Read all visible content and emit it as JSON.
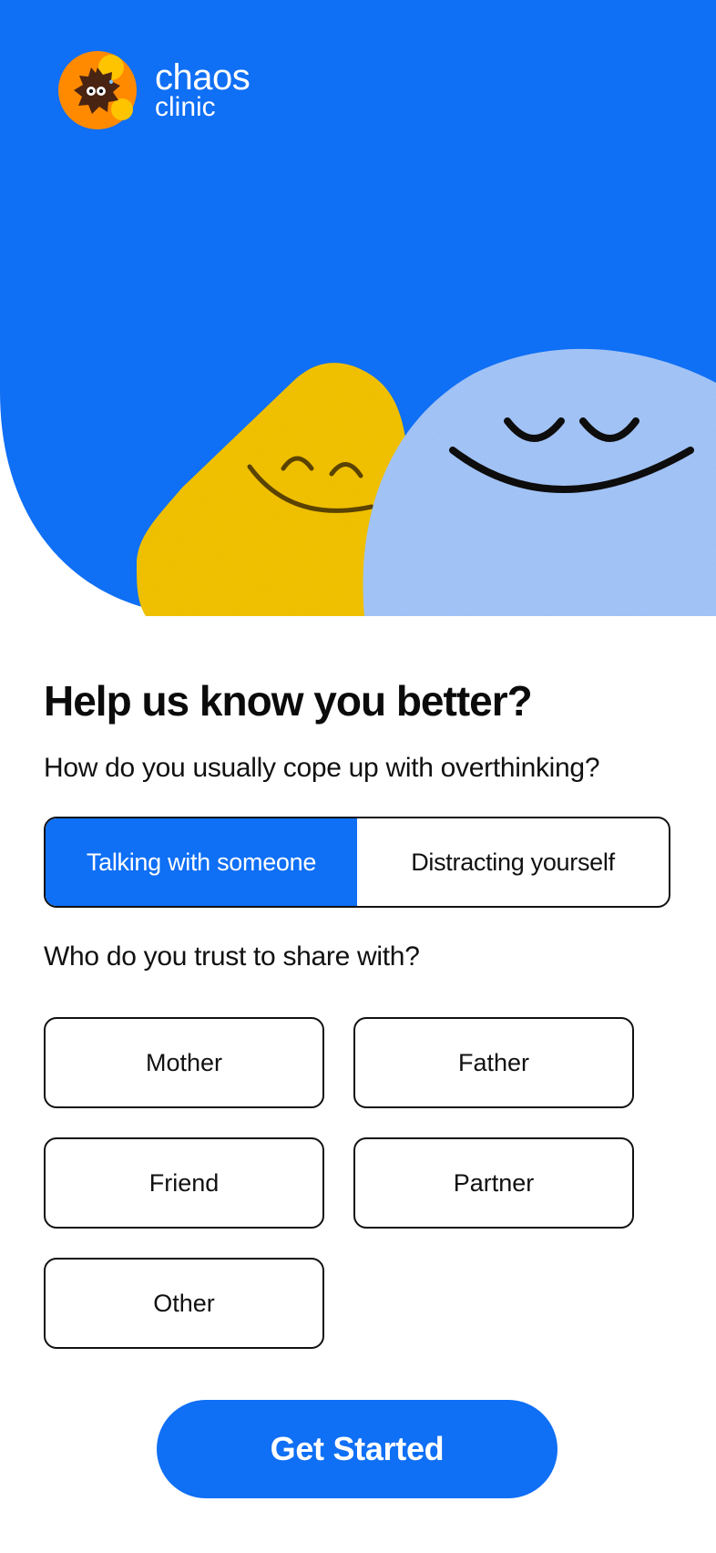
{
  "brand": {
    "name_line1": "chaos",
    "name_line2": "clinic",
    "logo_icon": "chaos-clinic-logo-icon"
  },
  "colors": {
    "primary": "#0f6ff5",
    "hero_blue": "#0f6ff5",
    "yellow_character": "#f9c800",
    "light_blue_character": "#a9cbff"
  },
  "illustration": {
    "icons": [
      "yellow-smiling-character-icon",
      "blue-smiling-character-icon"
    ]
  },
  "form": {
    "heading": "Help us know you better?",
    "question1": "How do you usually cope up with overthinking?",
    "coping_options": [
      {
        "label": "Talking with someone",
        "selected": true
      },
      {
        "label": "Distracting yourself",
        "selected": false
      }
    ],
    "question2": "Who do you trust to share with?",
    "trust_options": [
      {
        "label": "Mother"
      },
      {
        "label": "Father"
      },
      {
        "label": "Friend"
      },
      {
        "label": "Partner"
      },
      {
        "label": "Other"
      }
    ]
  },
  "cta": {
    "label": "Get Started"
  }
}
